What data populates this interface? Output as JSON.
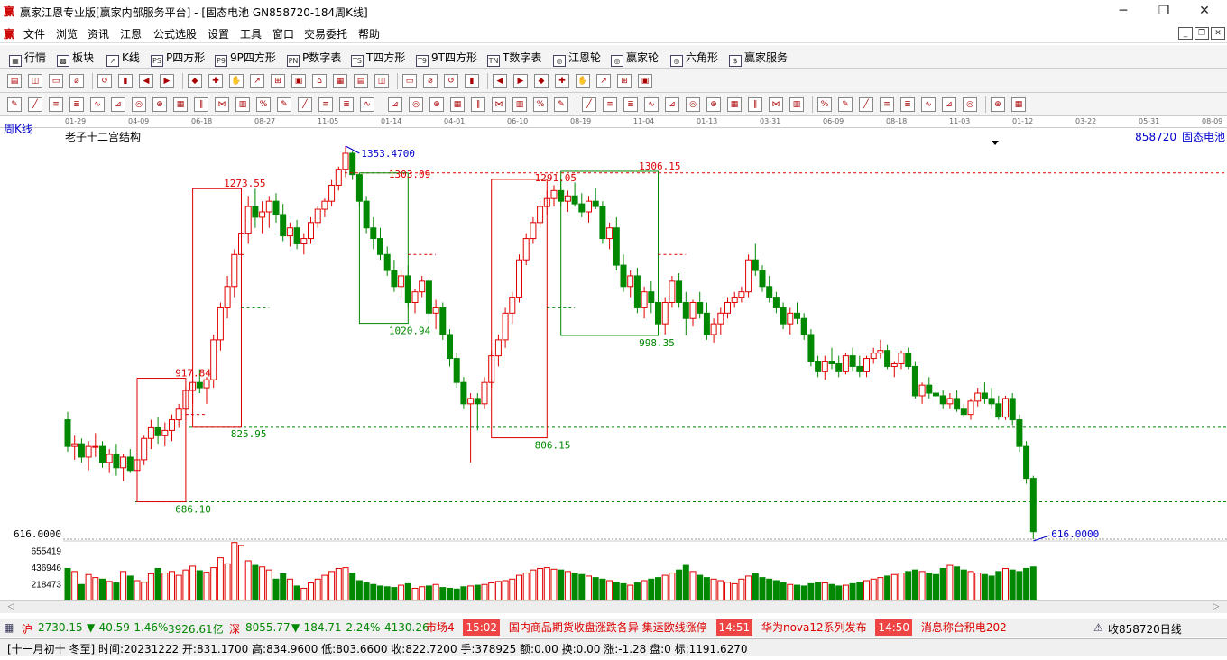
{
  "window": {
    "title": "赢家江恩专业版[赢家内部服务平台] - [固态电池  GN858720-184周K线]",
    "logo": "赢",
    "min": "─",
    "max": "❐",
    "close": "✕"
  },
  "menu": {
    "items": [
      "文件",
      "浏览",
      "资讯",
      "江恩",
      "公式选股",
      "设置",
      "工具",
      "窗口",
      "交易委托",
      "帮助"
    ],
    "mdi": [
      "_",
      "❐",
      "✕"
    ]
  },
  "toolbar1": {
    "items": [
      {
        "icon": "▦",
        "label": "行情"
      },
      {
        "icon": "▩",
        "label": "板块"
      },
      {
        "icon": "↗",
        "label": "K线"
      },
      {
        "icon": "PS",
        "label": "P四方形"
      },
      {
        "icon": "P9",
        "label": "9P四方形"
      },
      {
        "icon": "PN",
        "label": "P数字表"
      },
      {
        "icon": "TS",
        "label": "T四方形"
      },
      {
        "icon": "T9",
        "label": "9T四方形"
      },
      {
        "icon": "TN",
        "label": "T数字表"
      },
      {
        "icon": "◎",
        "label": "江恩轮"
      },
      {
        "icon": "◎",
        "label": "赢家轮"
      },
      {
        "icon": "◎",
        "label": "六角形"
      },
      {
        "icon": "$",
        "label": "赢家服务"
      }
    ]
  },
  "time_axis": [
    "01-29",
    "04-09",
    "06-18",
    "08-27",
    "11-05",
    "01-14",
    "04-01",
    "06-10",
    "08-19",
    "11-04",
    "01-13",
    "03-31",
    "06-09",
    "08-18",
    "11-03",
    "01-12",
    "03-22",
    "05-31",
    "08-09"
  ],
  "chart_header": {
    "period": "周K线",
    "indicator": "老子十二宫结构",
    "code": "858720",
    "name": "固态电池"
  },
  "price_axis": {
    "price_label": "616.0000",
    "volume_labels": [
      "655419",
      "436946",
      "218473"
    ]
  },
  "chart_data": {
    "type": "candlestick",
    "y_range": [
      616,
      1353.47
    ],
    "ohlc": [
      [
        840,
        855,
        780,
        790
      ],
      [
        790,
        810,
        765,
        795
      ],
      [
        795,
        805,
        760,
        770
      ],
      [
        770,
        800,
        745,
        790
      ],
      [
        790,
        815,
        770,
        790
      ],
      [
        790,
        800,
        750,
        760
      ],
      [
        760,
        785,
        740,
        775
      ],
      [
        775,
        795,
        735,
        750
      ],
      [
        750,
        775,
        725,
        770
      ],
      [
        770,
        785,
        740,
        745
      ],
      [
        745,
        770,
        735,
        765
      ],
      [
        765,
        810,
        755,
        805
      ],
      [
        805,
        840,
        785,
        825
      ],
      [
        825,
        845,
        795,
        810
      ],
      [
        810,
        835,
        790,
        820
      ],
      [
        820,
        850,
        800,
        840
      ],
      [
        840,
        870,
        825,
        860
      ],
      [
        860,
        900,
        840,
        895
      ],
      [
        895,
        930,
        870,
        910
      ],
      [
        910,
        935,
        890,
        900
      ],
      [
        900,
        920,
        870,
        915
      ],
      [
        915,
        1000,
        900,
        990
      ],
      [
        990,
        1060,
        970,
        1050
      ],
      [
        1050,
        1110,
        1030,
        1090
      ],
      [
        1090,
        1160,
        1070,
        1150
      ],
      [
        1150,
        1210,
        1130,
        1190
      ],
      [
        1190,
        1260,
        1170,
        1240
      ],
      [
        1240,
        1273.55,
        1200,
        1220
      ],
      [
        1220,
        1250,
        1190,
        1230
      ],
      [
        1230,
        1260,
        1200,
        1250
      ],
      [
        1250,
        1265,
        1210,
        1225
      ],
      [
        1225,
        1245,
        1175,
        1185
      ],
      [
        1185,
        1210,
        1165,
        1200
      ],
      [
        1200,
        1215,
        1160,
        1170
      ],
      [
        1170,
        1190,
        1150,
        1180
      ],
      [
        1180,
        1220,
        1170,
        1210
      ],
      [
        1210,
        1240,
        1200,
        1235
      ],
      [
        1235,
        1255,
        1220,
        1250
      ],
      [
        1250,
        1290,
        1240,
        1280
      ],
      [
        1280,
        1315,
        1270,
        1310
      ],
      [
        1310,
        1353.47,
        1295,
        1340
      ],
      [
        1340,
        1345,
        1290,
        1300
      ],
      [
        1300,
        1303.09,
        1240,
        1250
      ],
      [
        1250,
        1260,
        1190,
        1200
      ],
      [
        1200,
        1220,
        1160,
        1180
      ],
      [
        1180,
        1200,
        1140,
        1150
      ],
      [
        1150,
        1165,
        1110,
        1120
      ],
      [
        1120,
        1140,
        1080,
        1090
      ],
      [
        1090,
        1120,
        1070,
        1110
      ],
      [
        1110,
        1130,
        1050,
        1060
      ],
      [
        1060,
        1085,
        1040,
        1080
      ],
      [
        1080,
        1110,
        1070,
        1100
      ],
      [
        1100,
        1105,
        1020.94,
        1040
      ],
      [
        1040,
        1065,
        1010,
        1050
      ],
      [
        1050,
        1060,
        990,
        1000
      ],
      [
        1000,
        1010,
        940,
        955
      ],
      [
        955,
        965,
        900,
        910
      ],
      [
        910,
        920,
        860,
        870
      ],
      [
        870,
        890,
        760,
        880
      ],
      [
        880,
        890,
        820,
        870
      ],
      [
        870,
        920,
        860,
        910
      ],
      [
        910,
        970,
        900,
        960
      ],
      [
        960,
        1000,
        940,
        990
      ],
      [
        990,
        1050,
        975,
        1040
      ],
      [
        1040,
        1080,
        1020,
        1070
      ],
      [
        1070,
        1150,
        1060,
        1140
      ],
      [
        1140,
        1190,
        1130,
        1180
      ],
      [
        1180,
        1220,
        1170,
        1210
      ],
      [
        1210,
        1250,
        1200,
        1240
      ],
      [
        1240,
        1270,
        1225,
        1255
      ],
      [
        1255,
        1280,
        1240,
        1270
      ],
      [
        1270,
        1291.05,
        1240,
        1250
      ],
      [
        1250,
        1270,
        1230,
        1260
      ],
      [
        1260,
        1285,
        1240,
        1245
      ],
      [
        1245,
        1265,
        1220,
        1230
      ],
      [
        1230,
        1260,
        1210,
        1250
      ],
      [
        1250,
        1275,
        1235,
        1240
      ],
      [
        1240,
        1250,
        1170,
        1180
      ],
      [
        1180,
        1210,
        1160,
        1200
      ],
      [
        1200,
        1220,
        1120,
        1130
      ],
      [
        1130,
        1150,
        1080,
        1090
      ],
      [
        1090,
        1120,
        1070,
        1110
      ],
      [
        1110,
        1125,
        1040,
        1050
      ],
      [
        1050,
        1090,
        1030,
        1080
      ],
      [
        1080,
        1100,
        1040,
        1060
      ],
      [
        1060,
        1080,
        1010,
        1020
      ],
      [
        1020,
        1070,
        1000,
        1060
      ],
      [
        1060,
        1110,
        1050,
        1100
      ],
      [
        1100,
        1115,
        1050,
        1060
      ],
      [
        1060,
        1080,
        998.35,
        1030
      ],
      [
        1030,
        1065,
        1015,
        1060
      ],
      [
        1060,
        1080,
        1030,
        1040
      ],
      [
        1040,
        1060,
        990,
        1000
      ],
      [
        1000,
        1030,
        985,
        1020
      ],
      [
        1020,
        1050,
        1000,
        1040
      ],
      [
        1040,
        1070,
        1030,
        1060
      ],
      [
        1060,
        1080,
        1050,
        1070
      ],
      [
        1070,
        1090,
        1060,
        1080
      ],
      [
        1080,
        1150,
        1070,
        1140
      ],
      [
        1140,
        1170,
        1110,
        1120
      ],
      [
        1120,
        1130,
        1080,
        1090
      ],
      [
        1090,
        1110,
        1060,
        1070
      ],
      [
        1070,
        1080,
        1040,
        1050
      ],
      [
        1050,
        1060,
        1010,
        1020
      ],
      [
        1020,
        1050,
        1000,
        1040
      ],
      [
        1040,
        1060,
        1020,
        1030
      ],
      [
        1030,
        1040,
        990,
        1000
      ],
      [
        1000,
        1010,
        940,
        950
      ],
      [
        950,
        960,
        920,
        930
      ],
      [
        930,
        960,
        915,
        950
      ],
      [
        950,
        975,
        935,
        945
      ],
      [
        945,
        960,
        920,
        930
      ],
      [
        930,
        965,
        925,
        960
      ],
      [
        960,
        975,
        930,
        940
      ],
      [
        940,
        960,
        920,
        930
      ],
      [
        930,
        960,
        920,
        955
      ],
      [
        955,
        975,
        945,
        965
      ],
      [
        965,
        990,
        955,
        970
      ],
      [
        970,
        980,
        935,
        940
      ],
      [
        940,
        950,
        920,
        945
      ],
      [
        945,
        970,
        935,
        965
      ],
      [
        965,
        975,
        935,
        940
      ],
      [
        940,
        950,
        880,
        885
      ],
      [
        885,
        910,
        870,
        905
      ],
      [
        905,
        920,
        880,
        890
      ],
      [
        890,
        905,
        870,
        885
      ],
      [
        885,
        895,
        860,
        870
      ],
      [
        870,
        890,
        860,
        880
      ],
      [
        880,
        895,
        855,
        860
      ],
      [
        860,
        870,
        845,
        850
      ],
      [
        850,
        880,
        840,
        875
      ],
      [
        875,
        900,
        865,
        890
      ],
      [
        890,
        910,
        870,
        880
      ],
      [
        880,
        900,
        860,
        870
      ],
      [
        870,
        885,
        840,
        845
      ],
      [
        845,
        885,
        840,
        880
      ],
      [
        880,
        890,
        830,
        840
      ],
      [
        840,
        850,
        780,
        790
      ],
      [
        790,
        800,
        720,
        730
      ],
      [
        730,
        735,
        616,
        630
      ]
    ],
    "volume": [
      420000,
      380000,
      210000,
      340000,
      300000,
      280000,
      250000,
      230000,
      380000,
      320000,
      260000,
      240000,
      350000,
      420000,
      360000,
      380000,
      330000,
      400000,
      450000,
      390000,
      370000,
      430000,
      560000,
      480000,
      760000,
      720000,
      520000,
      460000,
      440000,
      400000,
      280000,
      350000,
      280000,
      190000,
      160000,
      230000,
      280000,
      330000,
      380000,
      420000,
      430000,
      360000,
      260000,
      230000,
      210000,
      190000,
      180000,
      170000,
      200000,
      220000,
      160000,
      180000,
      190000,
      210000,
      170000,
      160000,
      150000,
      180000,
      190000,
      200000,
      210000,
      230000,
      250000,
      260000,
      280000,
      330000,
      360000,
      400000,
      420000,
      430000,
      410000,
      400000,
      380000,
      360000,
      340000,
      320000,
      300000,
      280000,
      260000,
      240000,
      220000,
      200000,
      230000,
      260000,
      280000,
      300000,
      330000,
      360000,
      400000,
      460000,
      380000,
      330000,
      300000,
      280000,
      260000,
      240000,
      220000,
      280000,
      320000,
      350000,
      300000,
      280000,
      260000,
      230000,
      210000,
      200000,
      190000,
      220000,
      240000,
      230000,
      210000,
      190000,
      200000,
      220000,
      240000,
      260000,
      280000,
      300000,
      320000,
      340000,
      360000,
      380000,
      400000,
      380000,
      360000,
      340000,
      420000,
      460000,
      440000,
      400000,
      380000,
      360000,
      340000,
      320000,
      380000,
      420000,
      400000,
      380000,
      420000,
      440000
    ],
    "levels": [
      {
        "label": "1353.4700",
        "kind": "peak"
      },
      {
        "label": "1303.09",
        "kind": "high"
      },
      {
        "label": "1306.15",
        "kind": "high"
      },
      {
        "label": "1291.05",
        "kind": "high"
      },
      {
        "label": "1273.55",
        "kind": "high"
      },
      {
        "label": "917.84",
        "kind": "high"
      },
      {
        "label": "1020.94",
        "kind": "low"
      },
      {
        "label": "998.35",
        "kind": "low"
      },
      {
        "label": "825.95",
        "kind": "low"
      },
      {
        "label": "806.15",
        "kind": "low"
      },
      {
        "label": "686.10",
        "kind": "low"
      },
      {
        "label": "616.0000",
        "kind": "last"
      }
    ]
  },
  "status": {
    "idx1_value": "2730.15",
    "idx1_change": "▼-40.59",
    "idx1_pct": "-1.46%",
    "idx1_amount": "3926.61亿",
    "idx2_value": "8055.77",
    "idx2_change": "▼-184.71",
    "idx2_pct": "-2.24%",
    "idx2_amount": "4130.26",
    "ticker": [
      {
        "time": "",
        "text": "市场4"
      },
      {
        "time": "15:02",
        "text": "国内商品期货收盘涨跌各异 集运欧线涨停"
      },
      {
        "time": "14:51",
        "text": "华为nova12系列发布"
      },
      {
        "time": "14:50",
        "text": "消息称台积电202"
      }
    ],
    "right": "收858720日线"
  },
  "info": {
    "text": "[十一月初十 冬至] 时间:20231222 开:831.1700 高:834.9600 低:803.6600 收:822.7200 手:378925 额:0.00 换:0.00 涨:-1.28 盘:0 标:1191.6270"
  }
}
